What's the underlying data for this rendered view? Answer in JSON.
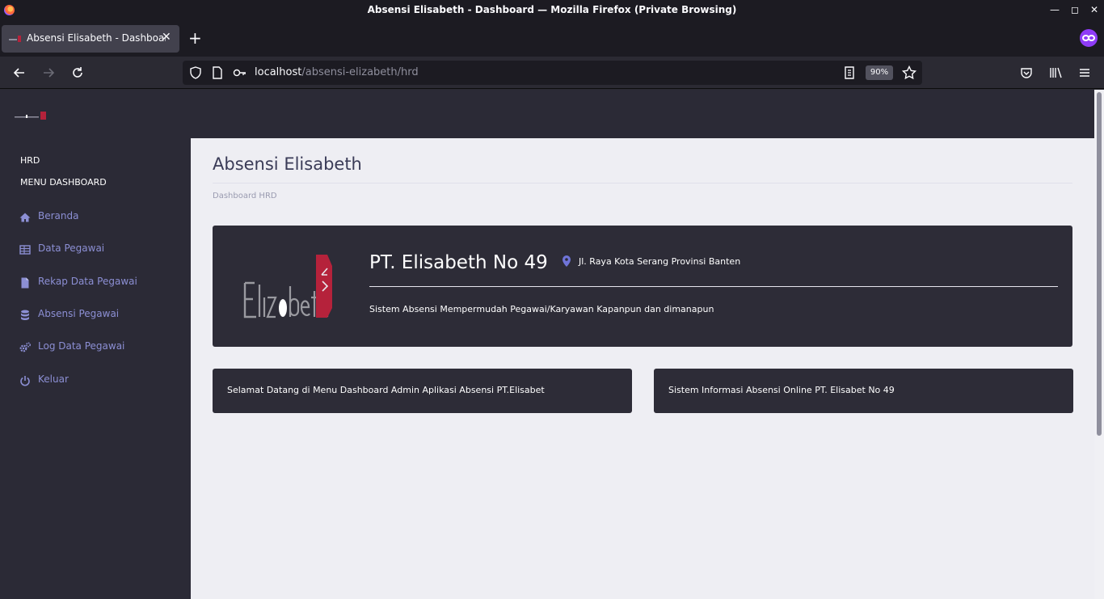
{
  "browser": {
    "window_title": "Absensi Elisabeth - Dashboard — Mozilla Firefox (Private Browsing)",
    "tab_title": "Absensi Elisabeth - Dashboard",
    "url_host": "localhost",
    "url_path": "/absensi-elizabeth/hrd",
    "zoom": "90%"
  },
  "sidebar": {
    "section_role": "HRD",
    "section_menu": "MENU DASHBOARD",
    "items": [
      {
        "label": "Beranda",
        "icon": "home-icon"
      },
      {
        "label": "Data Pegawai",
        "icon": "table-icon"
      },
      {
        "label": "Rekap Data Pegawai",
        "icon": "file-icon"
      },
      {
        "label": "Absensi Pegawai",
        "icon": "database-icon"
      },
      {
        "label": "Log Data Pegawai",
        "icon": "gears-icon"
      },
      {
        "label": "Keluar",
        "icon": "power-icon"
      }
    ]
  },
  "main": {
    "title": "Absensi Elisabeth",
    "breadcrumb": "Dashboard HRD",
    "hero": {
      "company": "PT. Elisabeth No 49",
      "address": "Jl. Raya Kota Serang Provinsi Banten",
      "tagline": "Sistem Absensi Mempermudah Pegawai/Karyawan Kapanpun dan dimanapun"
    },
    "cards": [
      "Selamat Datang di Menu Dashboard Admin Aplikasi Absensi PT.Elisabet",
      "Sistem Informasi Absensi Online PT. Elisabet No 49"
    ]
  },
  "colors": {
    "accent": "#8c8fd4",
    "sidebar_bg": "#2b2a36",
    "card_bg": "#2d2c37",
    "logo_red": "#b5223b"
  }
}
